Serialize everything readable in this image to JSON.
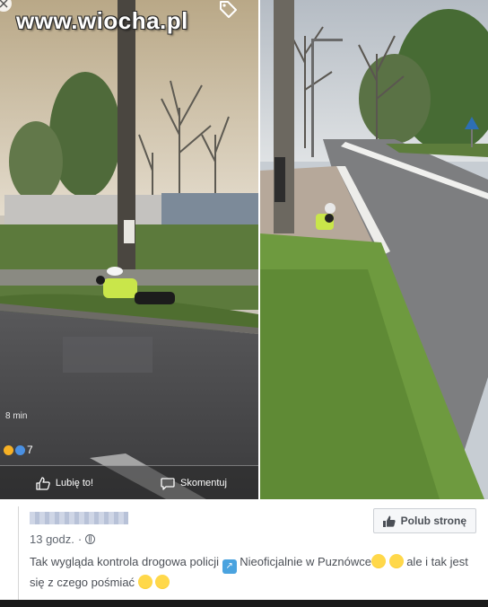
{
  "watermark": "www.wiocha.pl",
  "left_photo": {
    "time_overlay": "8 min",
    "reaction_count": "7",
    "like_label": "Lubię to!",
    "comment_label": "Skomentuj"
  },
  "post": {
    "time": "13 godz.",
    "like_page_label": "Polub stronę",
    "text_part1": "Tak wygląda kontrola drogowa policji",
    "text_part2": "Nieoficjalnie w Puznówce",
    "text_part3": "ale i tak jest się z czego pośmiać"
  },
  "colors": {
    "accent": "#4267b2",
    "text": "#4b4f56",
    "muted": "#616770"
  }
}
